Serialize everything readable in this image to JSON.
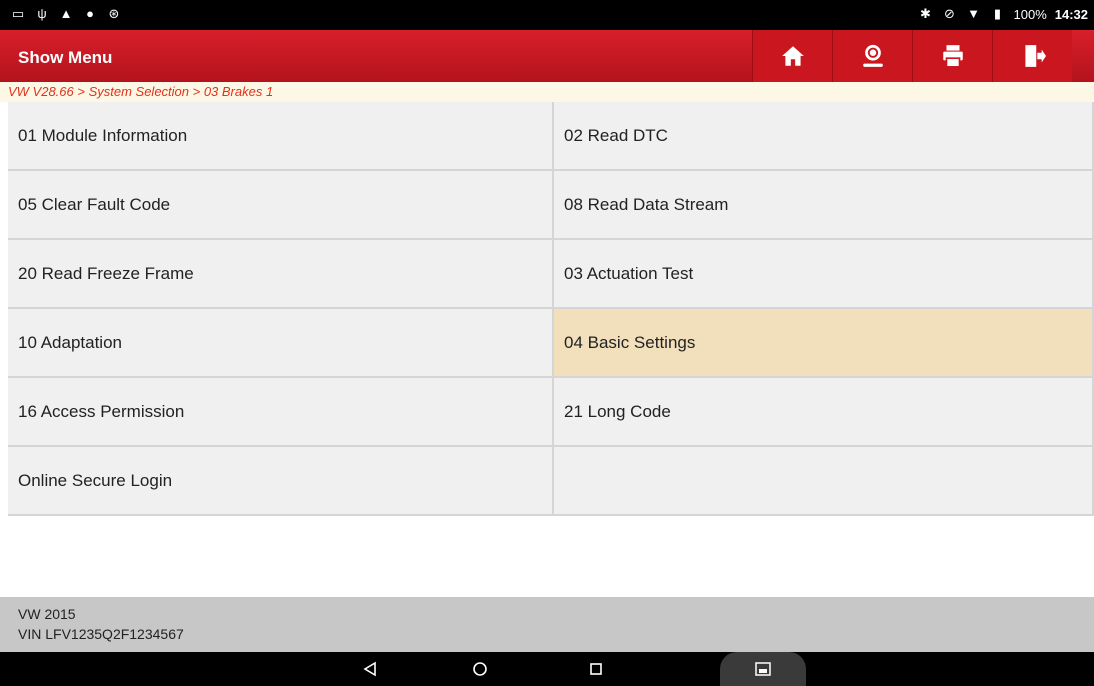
{
  "status_bar": {
    "left_icons": [
      "screenshot-icon",
      "usb-icon",
      "warning-icon",
      "chat-icon",
      "bluetooth-settings-icon"
    ],
    "battery_text": "100%",
    "time": "14:32"
  },
  "header": {
    "title": "Show Menu",
    "buttons": [
      "home-icon",
      "support-icon",
      "print-icon",
      "exit-icon"
    ]
  },
  "breadcrumb": "VW V28.66 > System Selection > 03 Brakes 1",
  "menu": {
    "items": [
      {
        "label": "01 Module Information"
      },
      {
        "label": "02 Read DTC"
      },
      {
        "label": "05 Clear Fault Code"
      },
      {
        "label": "08 Read Data Stream"
      },
      {
        "label": "20 Read Freeze Frame"
      },
      {
        "label": "03 Actuation Test"
      },
      {
        "label": "10 Adaptation"
      },
      {
        "label": "04 Basic Settings",
        "selected": true
      },
      {
        "label": "16 Access Permission"
      },
      {
        "label": "21 Long Code"
      },
      {
        "label": "Online Secure Login"
      },
      {
        "label": ""
      }
    ]
  },
  "info": {
    "vehicle": "VW  2015",
    "vin": "VIN LFV1235Q2F1234567"
  },
  "colors": {
    "header_red": "#c9161f",
    "highlight": "#f2e0bd",
    "breadcrumb_text": "#e0321c"
  }
}
